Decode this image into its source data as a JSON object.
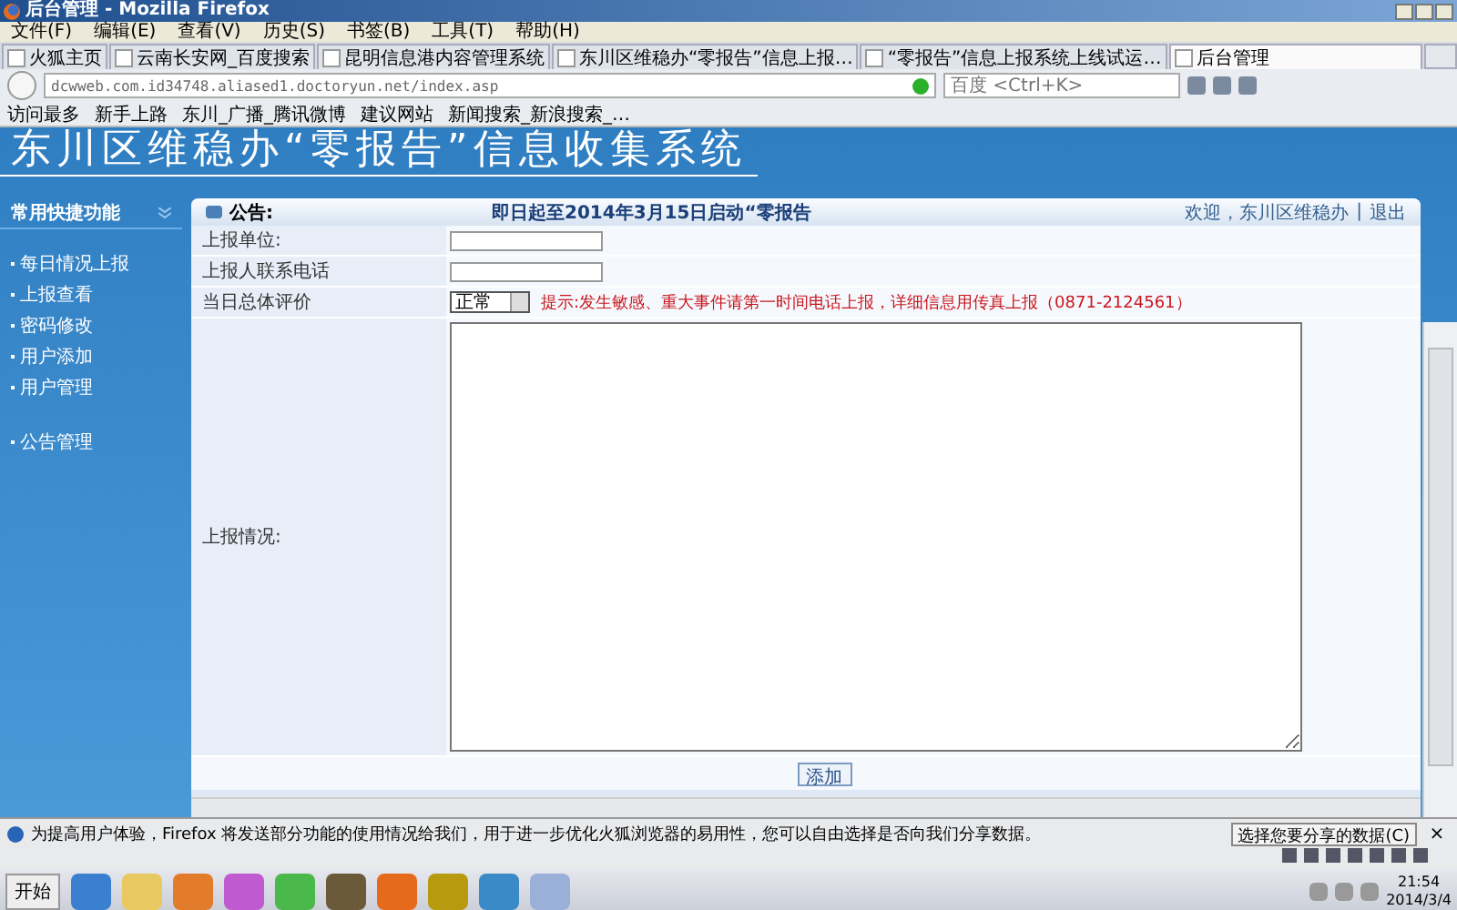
{
  "window": {
    "title": "后台管理 - Mozilla Firefox"
  },
  "menu": [
    "文件(F)",
    "编辑(E)",
    "查看(V)",
    "历史(S)",
    "书签(B)",
    "工具(T)",
    "帮助(H)"
  ],
  "tabs": [
    {
      "label": "火狐主页",
      "selected": false
    },
    {
      "label": "云南长安网_百度搜索",
      "selected": false
    },
    {
      "label": "昆明信息港内容管理系统",
      "selected": false
    },
    {
      "label": "东川区维稳办“零报告”信息上报…",
      "selected": false
    },
    {
      "label": "“零报告”信息上报系统上线试运…",
      "selected": false
    },
    {
      "label": "后台管理",
      "selected": true
    }
  ],
  "address_bar": {
    "url": "dcwweb.com.id34748.aliased1.doctoryun.net/index.asp"
  },
  "search": {
    "placeholder": "百度 <Ctrl+K>"
  },
  "bookmarks": [
    "访问最多",
    "新手上路",
    "东川_广播_腾讯微博",
    "建议网站",
    "新闻搜索_新浪搜索_…"
  ],
  "page": {
    "title": "东川区维稳办“零报告”信息收集系统",
    "sidebar": {
      "title": "常用快捷功能",
      "groups": [
        [
          "每日情况上报",
          "上报查看",
          "密码修改",
          "用户添加",
          "用户管理"
        ],
        [
          "公告管理"
        ]
      ]
    },
    "notice": {
      "label": "公告:",
      "text": "即日起至2014年3月15日启动“零报告"
    },
    "welcome": "欢迎，东川区维稳办",
    "separator": "|",
    "logout": "退出",
    "form": [
      {
        "label": "上报单位:",
        "kind": "input"
      },
      {
        "label": "上报人联系电话",
        "kind": "input"
      },
      {
        "label": "当日总体评价",
        "kind": "select",
        "value": "正常",
        "hint": "提示:发生敏感、重大事件请第一时间电话上报，详细信息用传真上报",
        "phone": "（0871-2124561）"
      },
      {
        "label": "上报情况:",
        "kind": "textarea"
      }
    ],
    "submit": "添加"
  },
  "notification": {
    "text": "为提高用户体验，Firefox 将发送部分功能的使用情况给我们，用于进一步优化火狐浏览器的易用性，您可以自由选择是否向我们分享数据。",
    "button": "选择您要分享的数据(C)",
    "close": "×"
  },
  "taskbar": {
    "start": "开始",
    "time": "21:54",
    "date": "2014/3/4"
  }
}
